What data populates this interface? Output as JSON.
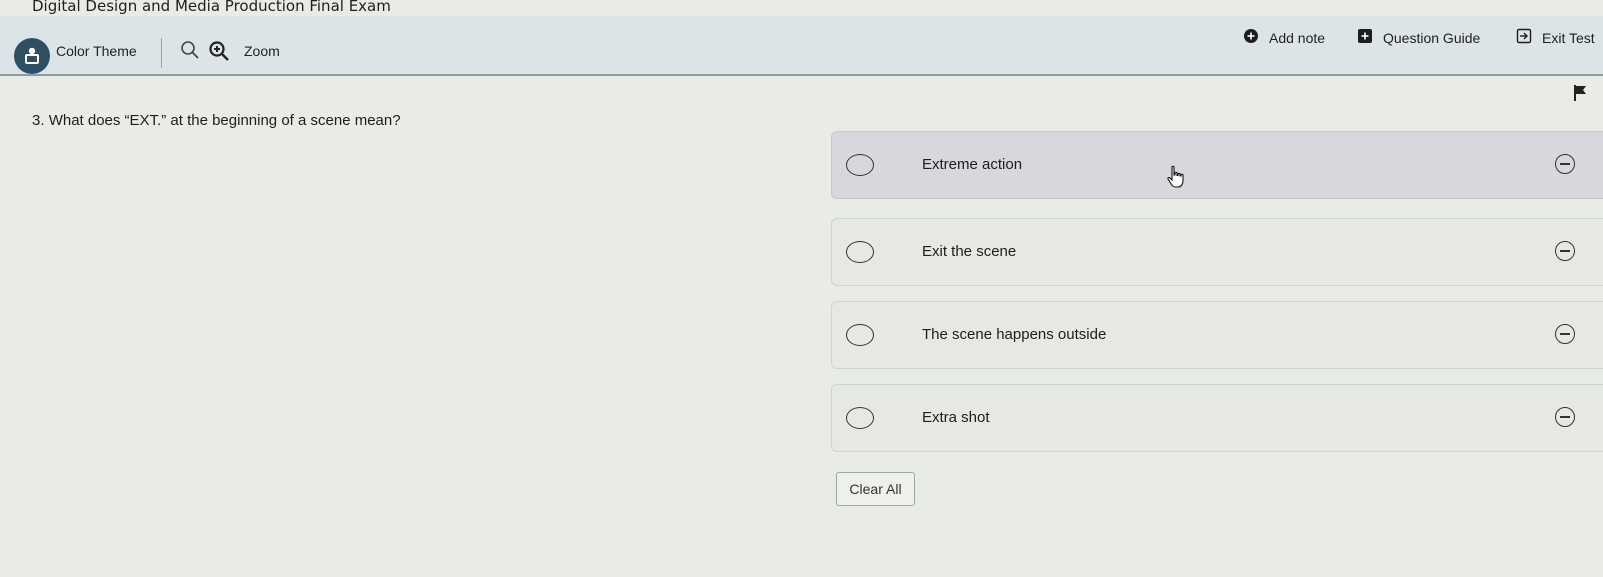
{
  "app": {
    "title": "Digital Design and Media Production Final Exam"
  },
  "toolbar": {
    "color_theme_label": "Color Theme",
    "zoom_label": "Zoom",
    "add_note_label": "Add note",
    "question_guide_label": "Question Guide",
    "exit_test_label": "Exit Test"
  },
  "question": {
    "number": "3.",
    "text": "What does “EXT.” at the beginning of a scene mean?"
  },
  "options": [
    {
      "label": "Extreme action"
    },
    {
      "label": "Exit the scene"
    },
    {
      "label": "The scene happens outside"
    },
    {
      "label": "Extra shot"
    }
  ],
  "actions": {
    "clear_all_label": "Clear All"
  },
  "colors": {
    "background": "#e9ebe6",
    "toolbar": "#dde4e7",
    "avatar": "#2f4f63",
    "option_hover": "#d9d6de"
  },
  "icons": [
    "accessibility-icon",
    "zoom-out-icon",
    "zoom-in-icon",
    "add-note-icon",
    "question-guide-icon",
    "exit-icon",
    "flag-icon",
    "strikethrough-icon",
    "pointer-cursor-icon"
  ]
}
